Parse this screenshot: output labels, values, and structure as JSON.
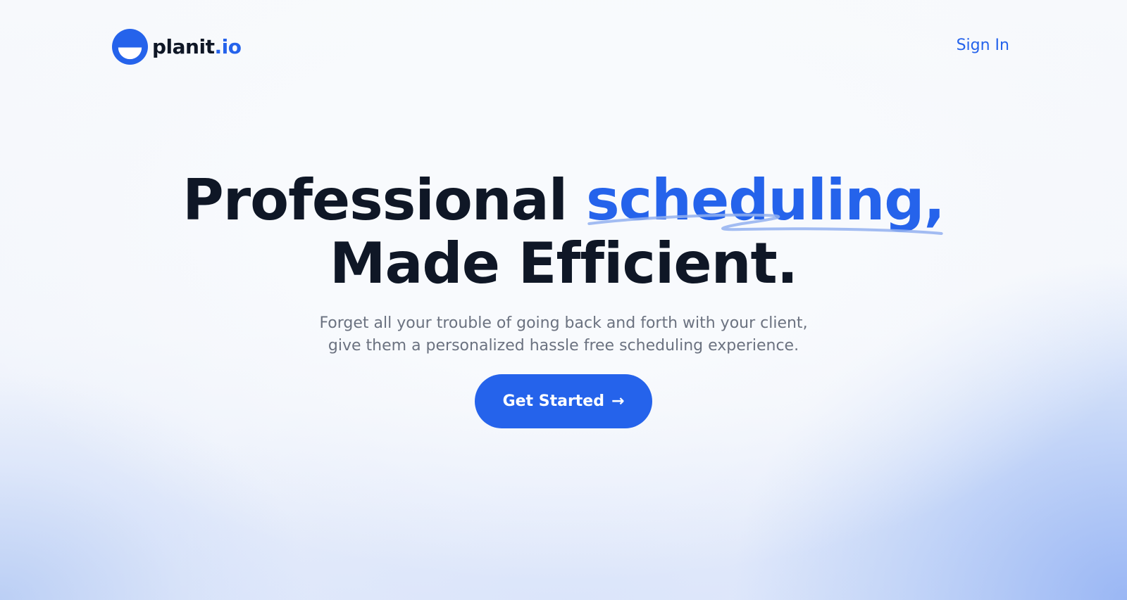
{
  "brand": {
    "name_main": "planit",
    "name_suffix": ".io",
    "logo_icon": "half-circle-smile-logo",
    "accent_color": "#2563eb",
    "dark_color": "#0f1726"
  },
  "nav": {
    "signin_label": "Sign In"
  },
  "hero": {
    "title_part1": "Professional",
    "title_highlight": "scheduling,",
    "title_line2": "Made Efficient.",
    "subtitle_line1": "Forget all your trouble of going back and forth with your client,",
    "subtitle_line2": "give them a personalized hassle free scheduling experience.",
    "cta_label": "Get Started",
    "cta_icon": "arrow-right-icon",
    "cta_arrow": "→"
  }
}
